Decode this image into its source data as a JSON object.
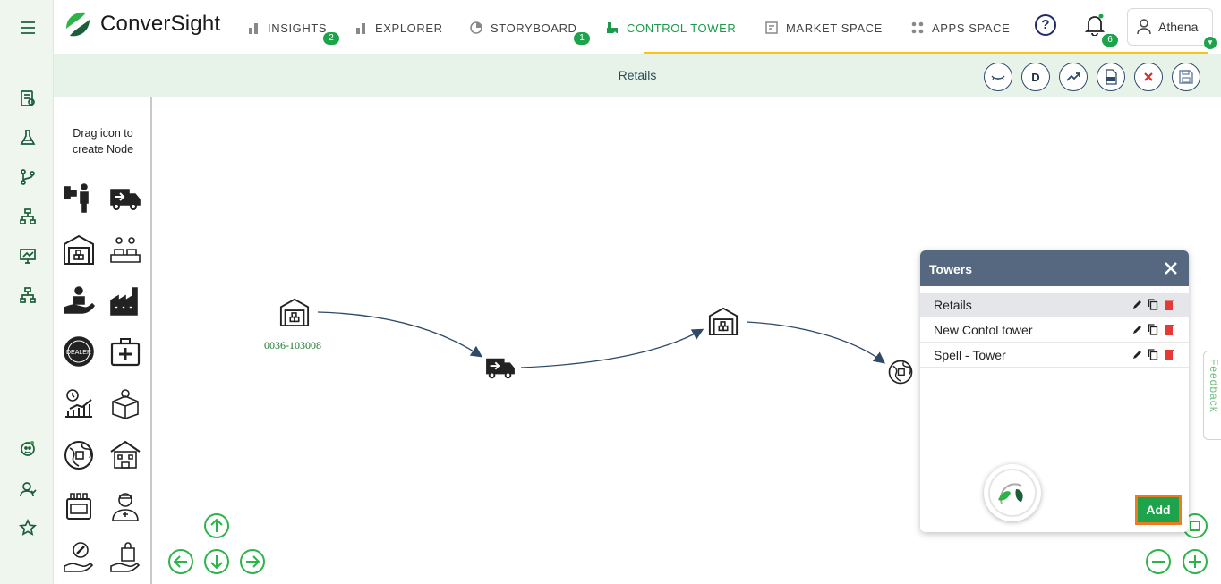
{
  "app": {
    "brand": "ConverSight"
  },
  "nav": {
    "items": [
      {
        "label": "INSIGHTS",
        "badge": "2"
      },
      {
        "label": "EXPLORER"
      },
      {
        "label": "STORYBOARD",
        "badge": "1"
      },
      {
        "label": "CONTROL TOWER",
        "active": true
      },
      {
        "label": "MARKET SPACE"
      },
      {
        "label": "APPS SPACE"
      }
    ],
    "notifications_badge": "6",
    "user_name": "Athena"
  },
  "subbar": {
    "title": "Retails",
    "d_button": "D"
  },
  "palette": {
    "hint_line1": "Drag icon to",
    "hint_line2": "create Node"
  },
  "canvas": {
    "node_label": "0036-103008"
  },
  "towers": {
    "title": "Towers",
    "items": [
      "Retails",
      "New Contol tower",
      "Spell - Tower"
    ],
    "selected_index": 0,
    "add_label": "Add"
  },
  "feedback": {
    "label": "Feedback"
  },
  "colors": {
    "brand_green": "#1ea34d",
    "header_slate": "#55687f",
    "accent_yellow": "#f5c518",
    "subbar_bg": "#e7f3e8"
  }
}
